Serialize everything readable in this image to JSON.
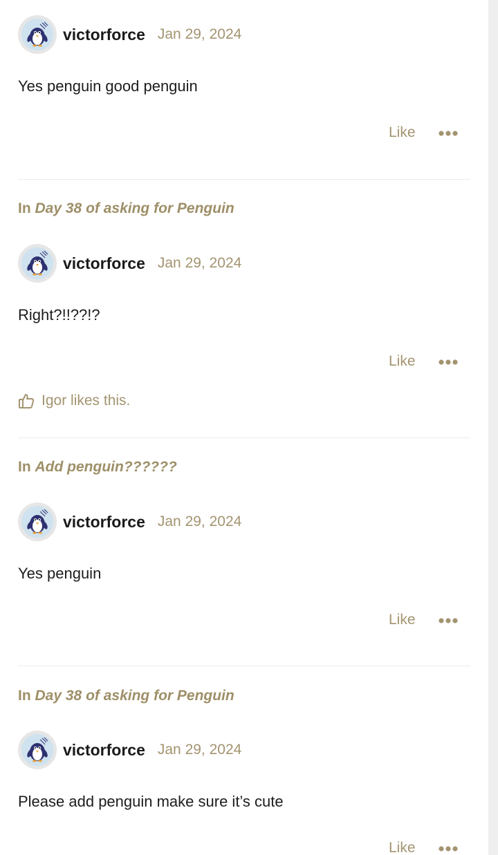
{
  "posts": [
    {
      "context": null,
      "author": "victorforce",
      "date": "Jan 29, 2024",
      "body": "Yes penguin good penguin",
      "like_label": "Like",
      "likes_text": null
    },
    {
      "context": {
        "prefix": "In",
        "thread": "Day 38 of asking for Penguin"
      },
      "author": "victorforce",
      "date": "Jan 29, 2024",
      "body": "Right?!!??!?",
      "like_label": "Like",
      "likes_text": "Igor likes this."
    },
    {
      "context": {
        "prefix": "In",
        "thread": "Add penguin??????"
      },
      "author": "victorforce",
      "date": "Jan 29, 2024",
      "body": "Yes penguin",
      "like_label": "Like",
      "likes_text": null
    },
    {
      "context": {
        "prefix": "In",
        "thread": "Day 38 of asking for Penguin"
      },
      "author": "victorforce",
      "date": "Jan 29, 2024",
      "body": "Please add penguin make sure it’s cute",
      "like_label": "Like",
      "likes_text": null
    }
  ],
  "icons": {
    "avatar": "penguin-avatar",
    "more": "more-options-icon",
    "likes": "thumbs-up-icon"
  },
  "colors": {
    "accent": "#a39470",
    "context": "#9e8f68",
    "text": "#1c1c1c",
    "divider": "#ececec"
  }
}
